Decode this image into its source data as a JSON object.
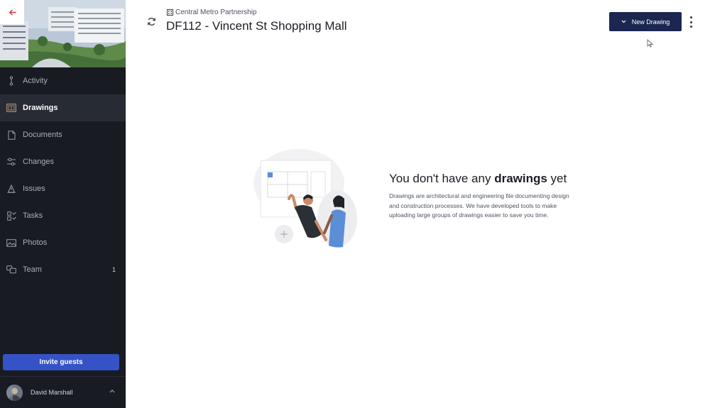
{
  "sidebar": {
    "items": [
      {
        "label": "Activity",
        "icon": "activity-icon",
        "active": false
      },
      {
        "label": "Drawings",
        "icon": "drawings-icon",
        "active": true
      },
      {
        "label": "Documents",
        "icon": "document-icon",
        "active": false
      },
      {
        "label": "Changes",
        "icon": "changes-icon",
        "active": false
      },
      {
        "label": "Issues",
        "icon": "issues-icon",
        "active": false
      },
      {
        "label": "Tasks",
        "icon": "tasks-icon",
        "active": false
      },
      {
        "label": "Photos",
        "icon": "photos-icon",
        "active": false
      },
      {
        "label": "Team",
        "icon": "team-icon",
        "active": false,
        "count": "1"
      }
    ],
    "invite_label": "Invite guests",
    "user_name": "David Marshall"
  },
  "header": {
    "org": "Central Metro Partnership",
    "title": "DF112 - Vincent St Shopping Mall",
    "new_drawing_label": "New Drawing"
  },
  "empty_state": {
    "title_prefix": "You don't have any ",
    "title_bold": "drawings",
    "title_suffix": " yet",
    "description": "Drawings are architectural and engineering file documenting design and construction processes. We have developed tools to make uploading large groups of drawings easier to save you time."
  },
  "colors": {
    "sidebar_bg": "#181b22",
    "active_item_bg": "#272b34",
    "invite_button": "#3553c6",
    "primary_button": "#1b2651",
    "back_arrow": "#d23b3b"
  }
}
